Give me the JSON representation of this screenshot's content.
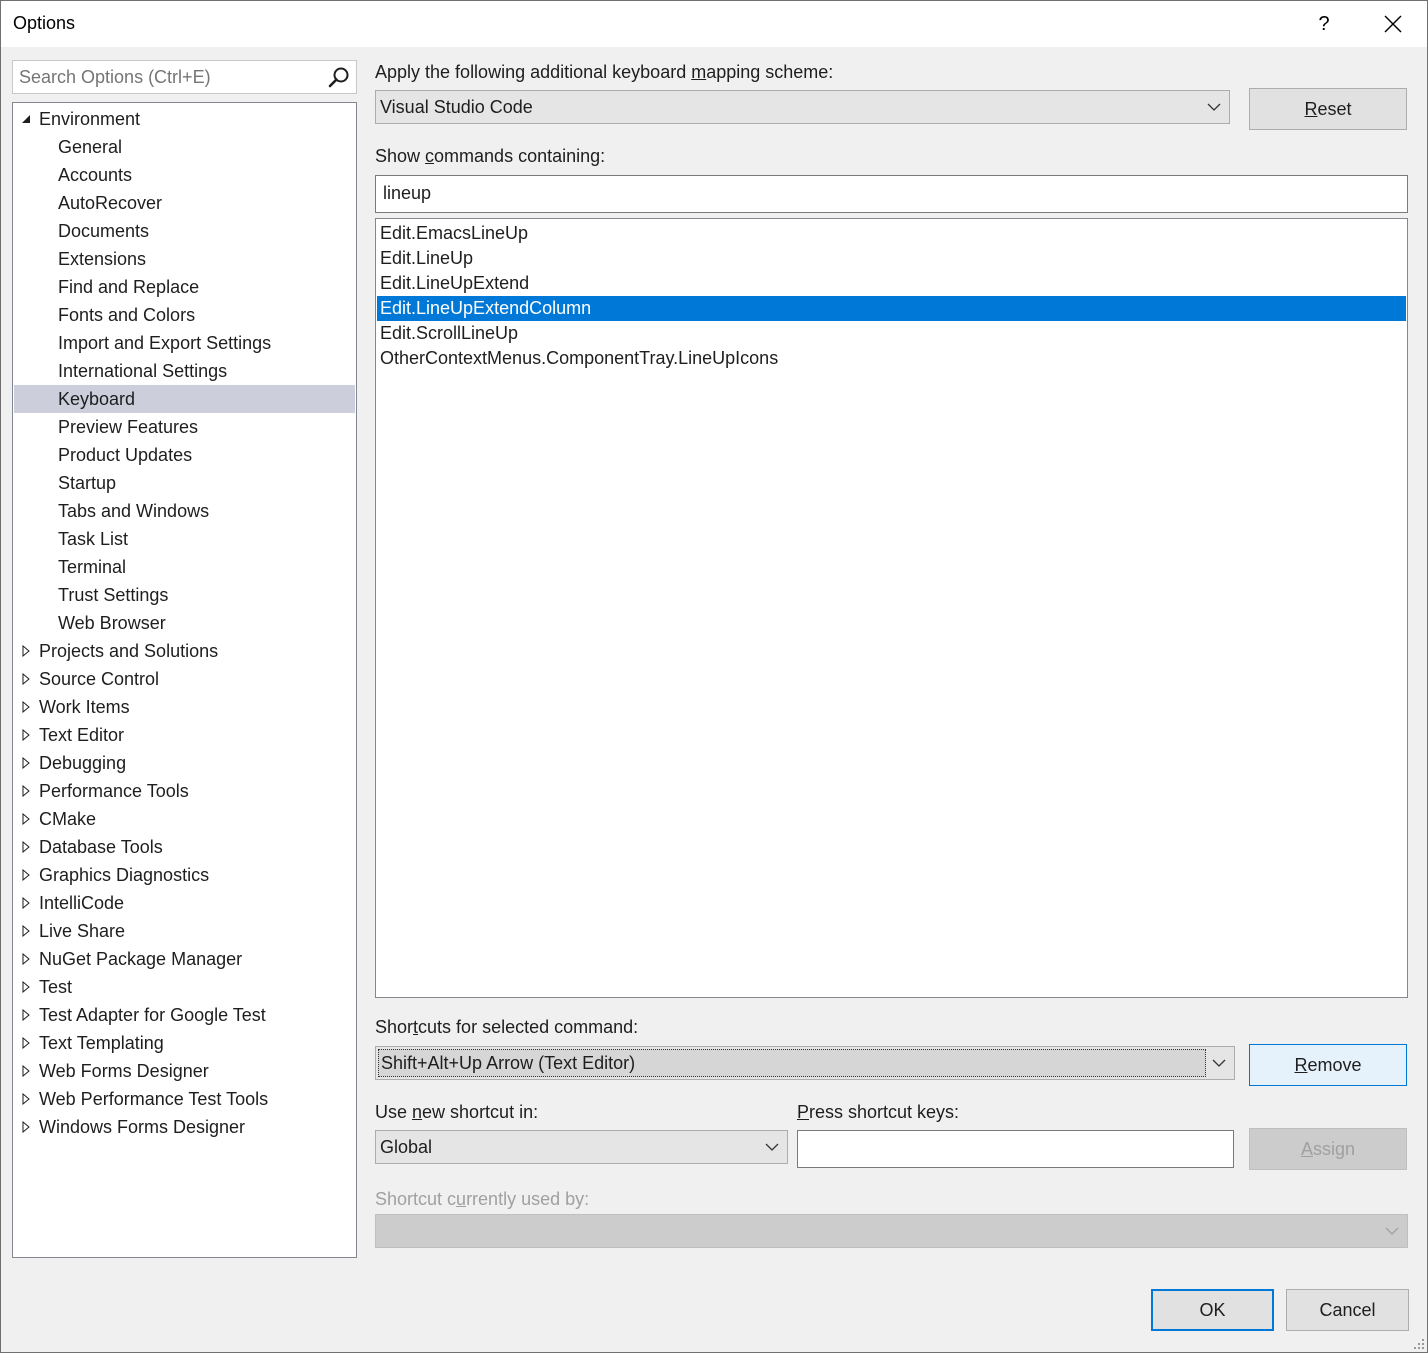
{
  "window": {
    "title": "Options",
    "help_glyph": "?"
  },
  "search": {
    "placeholder": "Search Options (Ctrl+E)"
  },
  "tree": {
    "items": [
      {
        "label": "Environment",
        "level": 0,
        "expanded": true
      },
      {
        "label": "General",
        "level": 1
      },
      {
        "label": "Accounts",
        "level": 1
      },
      {
        "label": "AutoRecover",
        "level": 1
      },
      {
        "label": "Documents",
        "level": 1
      },
      {
        "label": "Extensions",
        "level": 1
      },
      {
        "label": "Find and Replace",
        "level": 1
      },
      {
        "label": "Fonts and Colors",
        "level": 1
      },
      {
        "label": "Import and Export Settings",
        "level": 1
      },
      {
        "label": "International Settings",
        "level": 1
      },
      {
        "label": "Keyboard",
        "level": 1,
        "selected": true
      },
      {
        "label": "Preview Features",
        "level": 1
      },
      {
        "label": "Product Updates",
        "level": 1
      },
      {
        "label": "Startup",
        "level": 1
      },
      {
        "label": "Tabs and Windows",
        "level": 1
      },
      {
        "label": "Task List",
        "level": 1
      },
      {
        "label": "Terminal",
        "level": 1
      },
      {
        "label": "Trust Settings",
        "level": 1
      },
      {
        "label": "Web Browser",
        "level": 1
      },
      {
        "label": "Projects and Solutions",
        "level": 0,
        "expanded": false
      },
      {
        "label": "Source Control",
        "level": 0,
        "expanded": false
      },
      {
        "label": "Work Items",
        "level": 0,
        "expanded": false
      },
      {
        "label": "Text Editor",
        "level": 0,
        "expanded": false
      },
      {
        "label": "Debugging",
        "level": 0,
        "expanded": false
      },
      {
        "label": "Performance Tools",
        "level": 0,
        "expanded": false
      },
      {
        "label": "CMake",
        "level": 0,
        "expanded": false
      },
      {
        "label": "Database Tools",
        "level": 0,
        "expanded": false
      },
      {
        "label": "Graphics Diagnostics",
        "level": 0,
        "expanded": false
      },
      {
        "label": "IntelliCode",
        "level": 0,
        "expanded": false
      },
      {
        "label": "Live Share",
        "level": 0,
        "expanded": false
      },
      {
        "label": "NuGet Package Manager",
        "level": 0,
        "expanded": false
      },
      {
        "label": "Test",
        "level": 0,
        "expanded": false
      },
      {
        "label": "Test Adapter for Google Test",
        "level": 0,
        "expanded": false
      },
      {
        "label": "Text Templating",
        "level": 0,
        "expanded": false
      },
      {
        "label": "Web Forms Designer",
        "level": 0,
        "expanded": false
      },
      {
        "label": "Web Performance Test Tools",
        "level": 0,
        "expanded": false
      },
      {
        "label": "Windows Forms Designer",
        "level": 0,
        "expanded": false
      }
    ]
  },
  "mapping": {
    "label_pre": "Apply the following additional keyboard ",
    "label_key": "m",
    "label_post": "apping scheme:",
    "value": "Visual Studio Code",
    "reset_pre": "",
    "reset_key": "R",
    "reset_post": "eset"
  },
  "commands": {
    "label_pre": "Show ",
    "label_key": "c",
    "label_post": "ommands containing:",
    "filter": "lineup",
    "items": [
      {
        "label": "Edit.EmacsLineUp"
      },
      {
        "label": "Edit.LineUp"
      },
      {
        "label": "Edit.LineUpExtend"
      },
      {
        "label": "Edit.LineUpExtendColumn",
        "selected": true
      },
      {
        "label": "Edit.ScrollLineUp"
      },
      {
        "label": "OtherContextMenus.ComponentTray.LineUpIcons"
      }
    ]
  },
  "shortcuts": {
    "label_pre": "Shor",
    "label_key": "t",
    "label_post": "cuts for selected command:",
    "value": "Shift+Alt+Up Arrow (Text Editor)",
    "remove_pre": "",
    "remove_key": "R",
    "remove_post": "emove"
  },
  "new_shortcut": {
    "scope_pre": "Use ",
    "scope_key": "n",
    "scope_post": "ew shortcut in:",
    "scope_value": "Global",
    "keys_pre": "",
    "keys_key": "P",
    "keys_post": "ress shortcut keys:",
    "keys_value": "",
    "assign_pre": "",
    "assign_key": "A",
    "assign_post": "ssign"
  },
  "used_by": {
    "label_pre": "Shortcut c",
    "label_key": "u",
    "label_post": "rrently used by:",
    "value": ""
  },
  "footer": {
    "ok": "OK",
    "cancel": "Cancel"
  }
}
